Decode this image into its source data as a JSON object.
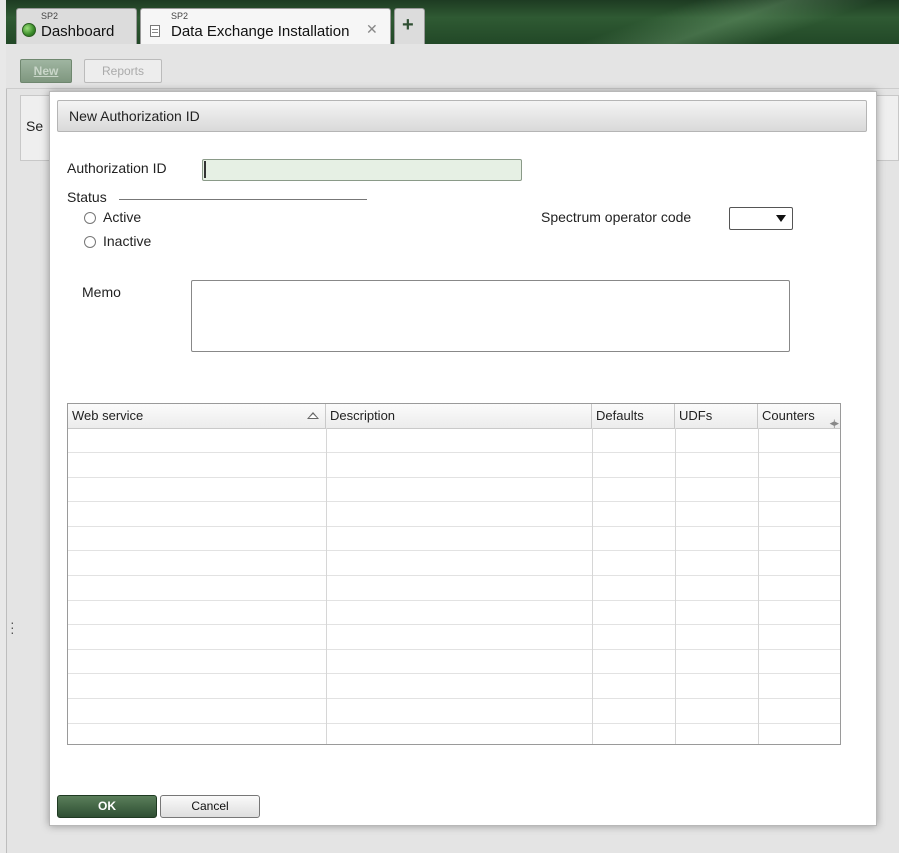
{
  "tabs": [
    {
      "small": "SP2",
      "label": "Dashboard",
      "icon": "globe-icon"
    },
    {
      "small": "SP2",
      "label": "Data Exchange Installation",
      "icon": "document-icon",
      "close": "✕"
    },
    {
      "label": "+",
      "icon": "plus-icon"
    }
  ],
  "toolbar": {
    "new_label": "New",
    "reports_label": "Reports"
  },
  "background": {
    "partial_label": "Se"
  },
  "dialog": {
    "title": "New Authorization ID",
    "authorization_id_label": "Authorization ID",
    "authorization_id_value": "",
    "status_label": "Status",
    "status_options": [
      "Active",
      "Inactive"
    ],
    "operator_code_label": "Spectrum operator code",
    "operator_code_value": "",
    "memo_label": "Memo",
    "memo_value": "",
    "grid": {
      "columns": [
        "Web service",
        "Description",
        "Defaults",
        "UDFs",
        "Counters"
      ],
      "sorted_column": "Web service",
      "rows": []
    },
    "ok_label": "OK",
    "cancel_label": "Cancel"
  },
  "colors": {
    "accent": "#2f4f33",
    "input_bg": "#e6f0e4"
  }
}
